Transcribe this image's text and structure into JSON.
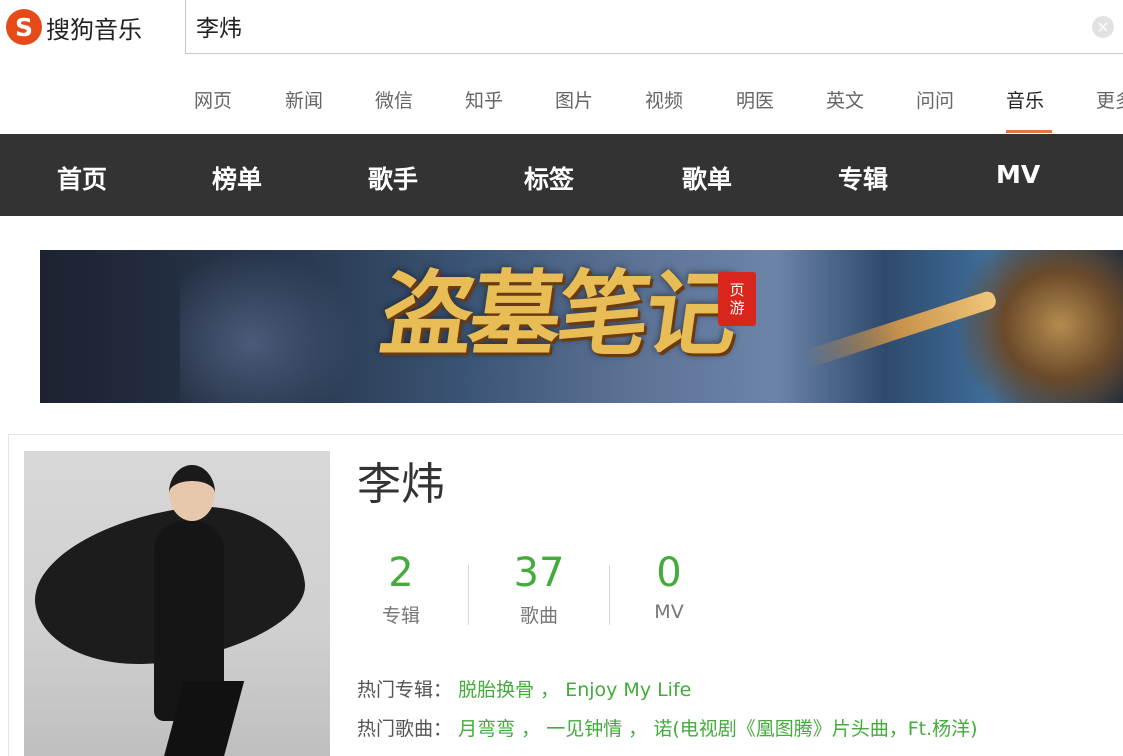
{
  "colors": {
    "accent_green": "#44ab3c",
    "nav_bg": "#333333",
    "active_tab_underline": "#e8734a",
    "logo_badge": "#e64a19"
  },
  "logo": {
    "icon": "sogou-s-icon",
    "badge_letter": "S",
    "text": "搜狗音乐"
  },
  "search": {
    "value": "李炜",
    "clear_icon": "close-icon",
    "clear_glyph": "×"
  },
  "vertical_tabs": [
    {
      "label": "网页",
      "active": false
    },
    {
      "label": "新闻",
      "active": false
    },
    {
      "label": "微信",
      "active": false
    },
    {
      "label": "知乎",
      "active": false
    },
    {
      "label": "图片",
      "active": false
    },
    {
      "label": "视频",
      "active": false
    },
    {
      "label": "明医",
      "active": false
    },
    {
      "label": "英文",
      "active": false
    },
    {
      "label": "问问",
      "active": false
    },
    {
      "label": "音乐",
      "active": true
    },
    {
      "label": "更多",
      "active": false
    }
  ],
  "music_nav": [
    {
      "label": "首页"
    },
    {
      "label": "榜单"
    },
    {
      "label": "歌手"
    },
    {
      "label": "标签"
    },
    {
      "label": "歌单"
    },
    {
      "label": "专辑"
    },
    {
      "label": "MV"
    }
  ],
  "banner": {
    "title": "盗墓笔记",
    "stamp_line1": "页",
    "stamp_line2": "游"
  },
  "artist": {
    "name": "李炜",
    "stats": [
      {
        "value": "2",
        "label": "专辑"
      },
      {
        "value": "37",
        "label": "歌曲"
      },
      {
        "value": "0",
        "label": "MV"
      }
    ],
    "hot_albums_label": "热门专辑：",
    "hot_albums": [
      "脱胎换骨",
      "Enjoy My Life"
    ],
    "hot_songs_label": "热门歌曲：",
    "hot_songs": [
      "月弯弯",
      "一见钟情",
      "诺(电视剧《凰图腾》片头曲，Ft.杨洋)"
    ],
    "separator": "，"
  }
}
